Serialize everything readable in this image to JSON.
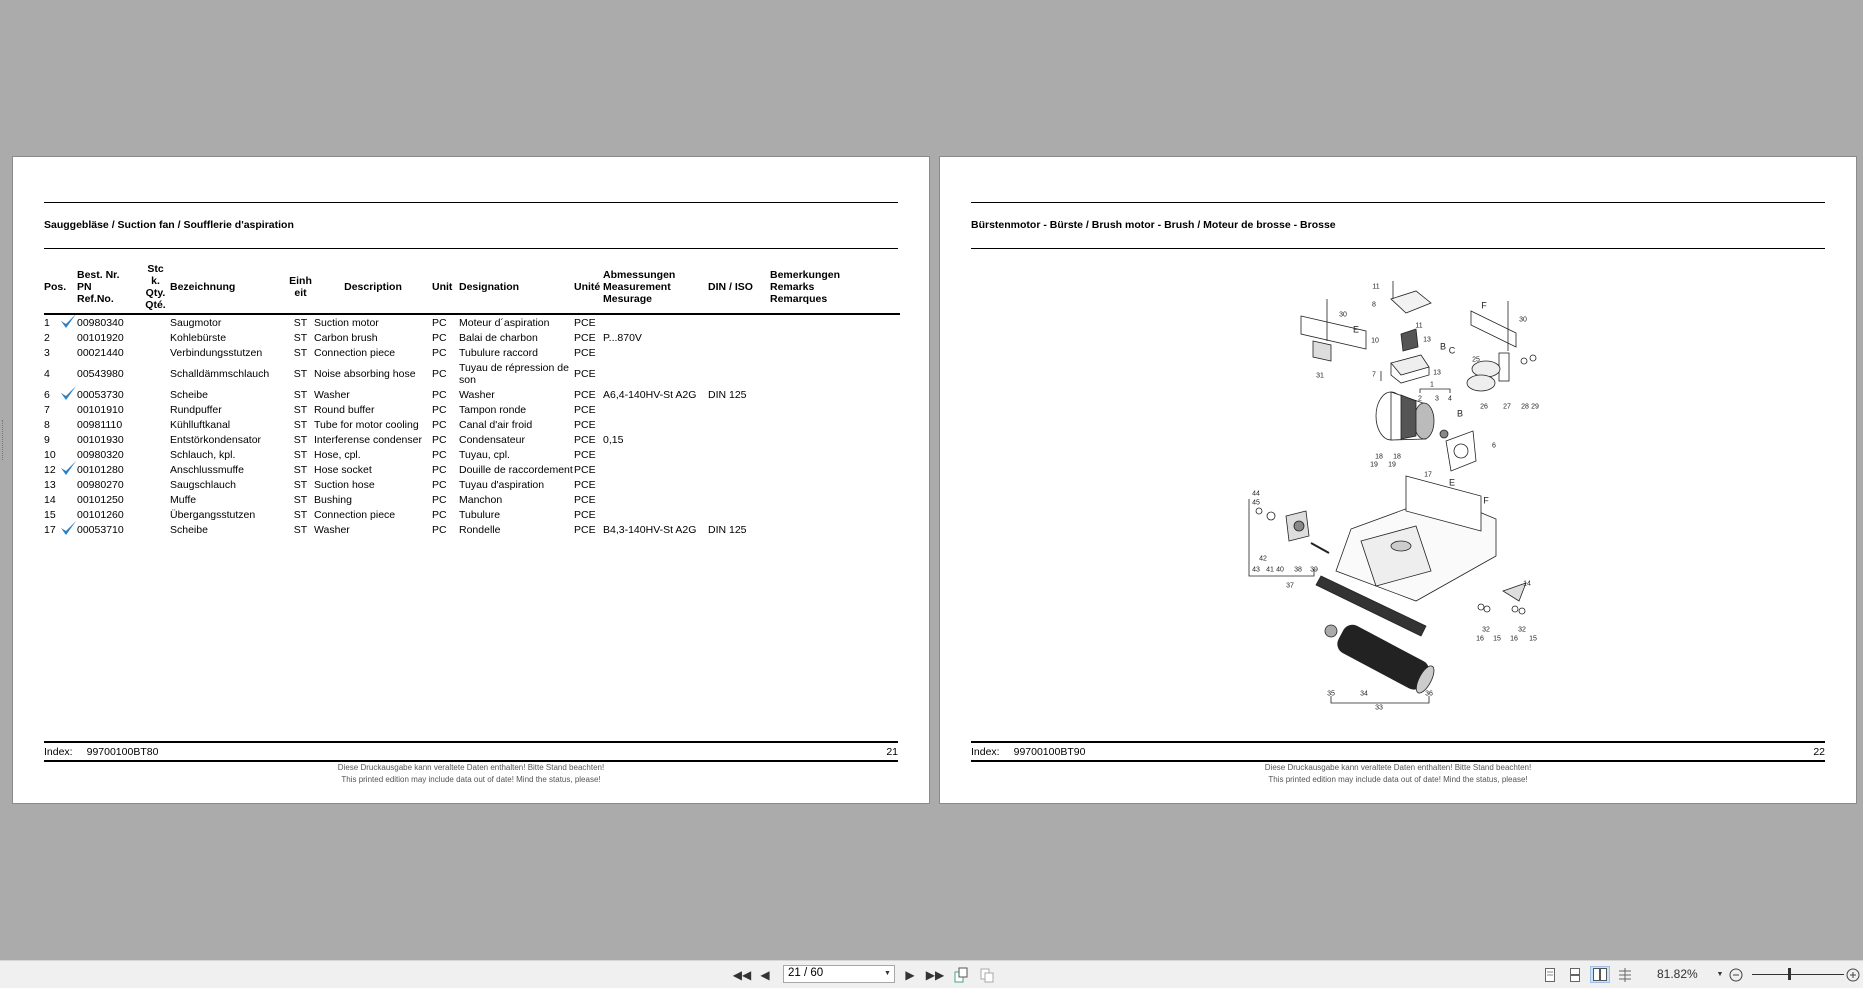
{
  "viewer": {
    "page_field": "21 / 60",
    "zoom_level": "81.82%",
    "icons": [
      "first-page-icon",
      "prev-page-icon",
      "next-page-icon",
      "last-page-icon",
      "extract-pages-icon",
      "insert-pages-icon",
      "single-page-view-icon",
      "continuous-view-icon",
      "two-page-view-icon",
      "two-page-continuous-view-icon",
      "zoom-out-icon",
      "zoom-in-icon"
    ]
  },
  "left_page": {
    "title": "Sauggebläse / Suction fan / Soufflerie d'aspiration",
    "columns": {
      "pos": "Pos.",
      "nr": [
        "Best. Nr.",
        "PN",
        "Ref.No."
      ],
      "qty": [
        "Stc",
        "k.",
        "Qty.",
        "Qté."
      ],
      "bez": "Bezeichnung",
      "einh": [
        "Einh",
        "eit"
      ],
      "desc": "Description",
      "unit": "Unit",
      "des": "Designation",
      "unite": "Unité",
      "abm": [
        "Abmessungen",
        "Measurement",
        "Mesurage"
      ],
      "din": "DIN / ISO",
      "rem": [
        "Bemerkungen",
        "Remarks",
        "Remarques"
      ]
    },
    "rows": [
      {
        "pos": "1",
        "check": true,
        "nr": "00980340",
        "bez": "Saugmotor",
        "einh": "ST",
        "desc": "Suction motor",
        "unit": "PC",
        "des": "Moteur d´aspiration",
        "unite": "PCE",
        "abm": "",
        "din": ""
      },
      {
        "pos": "2",
        "check": false,
        "nr": "00101920",
        "bez": "Kohlebürste",
        "einh": "ST",
        "desc": "Carbon brush",
        "unit": "PC",
        "des": "Balai de charbon",
        "unite": "PCE",
        "abm": "P...870V",
        "din": ""
      },
      {
        "pos": "3",
        "check": false,
        "nr": "00021440",
        "bez": "Verbindungsstutzen",
        "einh": "ST",
        "desc": "Connection piece",
        "unit": "PC",
        "des": "Tubulure raccord",
        "unite": "PCE",
        "abm": "",
        "din": ""
      },
      {
        "pos": "4",
        "check": false,
        "nr": "00543980",
        "bez": "Schalldämmschlauch",
        "einh": "ST",
        "desc": "Noise absorbing hose",
        "unit": "PC",
        "des": "Tuyau de répression de son",
        "unite": "PCE",
        "abm": "",
        "din": ""
      },
      {
        "pos": "6",
        "check": true,
        "nr": "00053730",
        "bez": "Scheibe",
        "einh": "ST",
        "desc": "Washer",
        "unit": "PC",
        "des": "Washer",
        "unite": "PCE",
        "abm": "A6,4-140HV-St A2G",
        "din": "DIN 125"
      },
      {
        "pos": "7",
        "check": false,
        "nr": "00101910",
        "bez": "Rundpuffer",
        "einh": "ST",
        "desc": "Round buffer",
        "unit": "PC",
        "des": "Tampon ronde",
        "unite": "PCE",
        "abm": "",
        "din": ""
      },
      {
        "pos": "8",
        "check": false,
        "nr": "00981110",
        "bez": "Kühlluftkanal",
        "einh": "ST",
        "desc": "Tube for motor cooling",
        "unit": "PC",
        "des": "Canal d'air froid",
        "unite": "PCE",
        "abm": "",
        "din": ""
      },
      {
        "pos": "9",
        "check": false,
        "nr": "00101930",
        "bez": "Entstörkondensator",
        "einh": "ST",
        "desc": "Interferense condenser",
        "unit": "PC",
        "des": "Condensateur",
        "unite": "PCE",
        "abm": "0,15",
        "din": ""
      },
      {
        "pos": "10",
        "check": false,
        "nr": "00980320",
        "bez": "Schlauch, kpl.",
        "einh": "ST",
        "desc": "Hose, cpl.",
        "unit": "PC",
        "des": "Tuyau, cpl.",
        "unite": "PCE",
        "abm": "",
        "din": ""
      },
      {
        "pos": "12",
        "check": true,
        "nr": "00101280",
        "bez": "Anschlussmuffe",
        "einh": "ST",
        "desc": "Hose socket",
        "unit": "PC",
        "des": "Douille de raccordement",
        "unite": "PCE",
        "abm": "",
        "din": ""
      },
      {
        "pos": "13",
        "check": false,
        "nr": "00980270",
        "bez": "Saugschlauch",
        "einh": "ST",
        "desc": "Suction hose",
        "unit": "PC",
        "des": "Tuyau d'aspiration",
        "unite": "PCE",
        "abm": "",
        "din": ""
      },
      {
        "pos": "14",
        "check": false,
        "nr": "00101250",
        "bez": "Muffe",
        "einh": "ST",
        "desc": "Bushing",
        "unit": "PC",
        "des": "Manchon",
        "unite": "PCE",
        "abm": "",
        "din": ""
      },
      {
        "pos": "15",
        "check": false,
        "nr": "00101260",
        "bez": "Übergangsstutzen",
        "einh": "ST",
        "desc": "Connection piece",
        "unit": "PC",
        "des": "Tubulure",
        "unite": "PCE",
        "abm": "",
        "din": ""
      },
      {
        "pos": "17",
        "check": true,
        "nr": "00053710",
        "bez": "Scheibe",
        "einh": "ST",
        "desc": "Washer",
        "unit": "PC",
        "des": "Rondelle",
        "unite": "PCE",
        "abm": "B4,3-140HV-St A2G",
        "din": "DIN 125"
      }
    ],
    "index_label": "Index:",
    "index_value": "99700100BT80",
    "page_number": "21",
    "note_de": "Diese Druckausgabe kann veraltete Daten enthalten! Bitte Stand beachten!",
    "note_en": "This printed edition may include data out of date! Mind the status, please!",
    "check_color": "#2a7fc4"
  },
  "right_page": {
    "title": "Bürstenmotor - Bürste / Brush motor - Brush / Moteur de brosse - Brosse",
    "diagram_callouts": [
      "11",
      "8",
      "30",
      "E",
      "11",
      "10",
      "13",
      "B",
      "C",
      "13",
      "7",
      "31",
      "F",
      "30",
      "25",
      "26",
      "27",
      "28",
      "29",
      "1",
      "2",
      "3",
      "4",
      "B",
      "6",
      "18",
      "18",
      "19",
      "19",
      "17",
      "E",
      "F",
      "44",
      "45",
      "43",
      "42",
      "41",
      "40",
      "38",
      "39",
      "37",
      "14",
      "16",
      "32",
      "15",
      "16",
      "32",
      "15",
      "35",
      "34",
      "36",
      "33"
    ],
    "index_label": "Index:",
    "index_value": "99700100BT90",
    "page_number": "22",
    "note_de": "Diese Druckausgabe kann veraltete Daten enthalten! Bitte Stand beachten!",
    "note_en": "This printed edition may include data out of date! Mind the status, please!"
  }
}
